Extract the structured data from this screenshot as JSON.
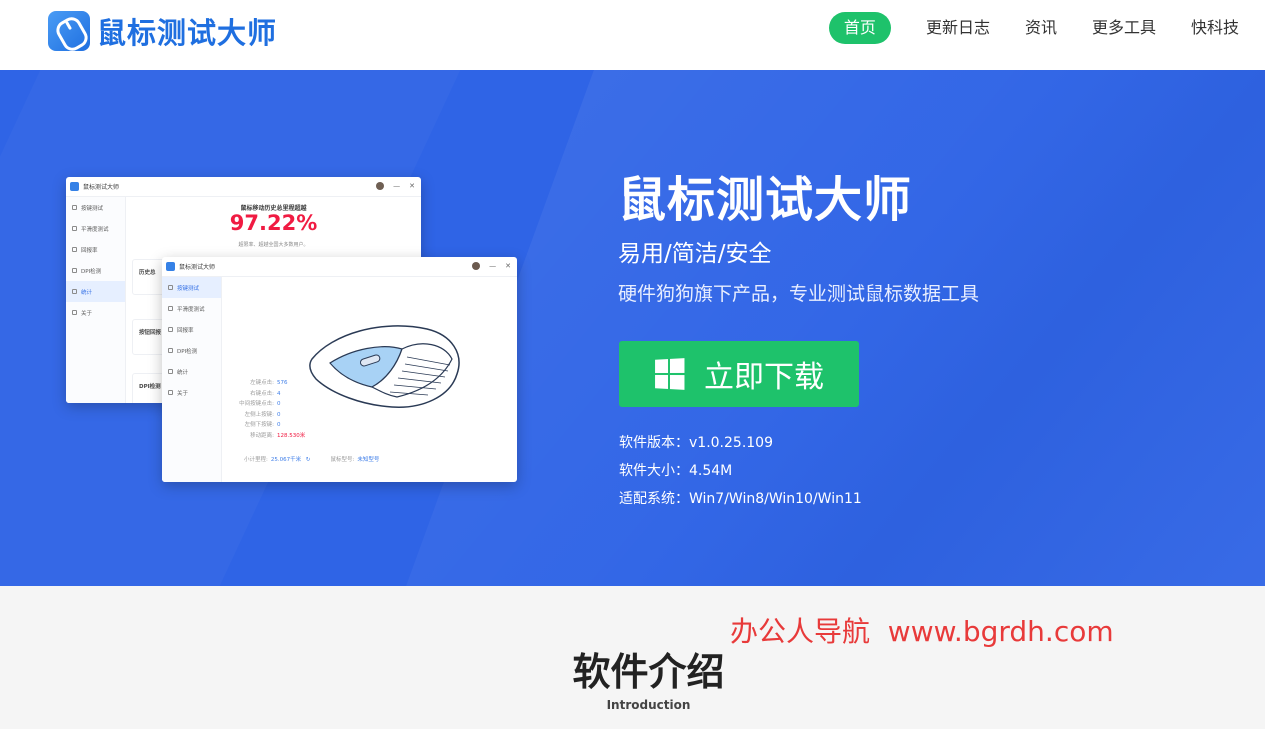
{
  "header": {
    "logo_text": "鼠标测试大师",
    "nav": [
      "首页",
      "更新日志",
      "资讯",
      "更多工具",
      "快科技"
    ]
  },
  "hero": {
    "title": "鼠标测试大师",
    "subtitle": "易用/简洁/安全",
    "description": "硬件狗狗旗下产品，专业测试鼠标数据工具",
    "download_label": "立即下载",
    "version": "软件版本：v1.0.25.109",
    "size": "软件大小：4.54M",
    "systems": "适配系统：Win7/Win8/Win10/Win11"
  },
  "app_back": {
    "title": "鼠标测试大师",
    "history_title": "鼠标移动历史总里程超越",
    "percent": "97.22%",
    "history_sub": "超限率、超越全国大多数用户。",
    "menu": [
      "按键测试",
      "平滑度测试",
      "回报率",
      "DPI检测",
      "统计",
      "关于"
    ],
    "cards": [
      "历史总",
      "按钮回报",
      "DPI检测"
    ]
  },
  "app_front": {
    "title": "鼠标测试大师",
    "menu": [
      "按键测试",
      "平滑度测试",
      "回报率",
      "DPI检测",
      "统计",
      "关于"
    ],
    "stats": [
      {
        "k": "左键点击:",
        "v": "576"
      },
      {
        "k": "右键点击:",
        "v": "4"
      },
      {
        "k": "中间按键点击:",
        "v": "0"
      },
      {
        "k": "左侧上按键:",
        "v": "0"
      },
      {
        "k": "左侧下按键:",
        "v": "0"
      },
      {
        "k": "移动距离:",
        "v": "128.530米"
      }
    ],
    "footer_left_k": "小计里程:",
    "footer_left_v": "25.067千米",
    "footer_right_k": "鼠标型号:",
    "footer_right_v": "未知型号"
  },
  "intro": {
    "watermark": "办公人导航  www.bgrdh.com",
    "title": "软件介绍",
    "subtitle": "Introduction"
  },
  "colors": {
    "brand_blue": "#1f6fe0",
    "hero_blue": "#2f64e6",
    "green": "#1ec26b",
    "red": "#f0143c"
  }
}
